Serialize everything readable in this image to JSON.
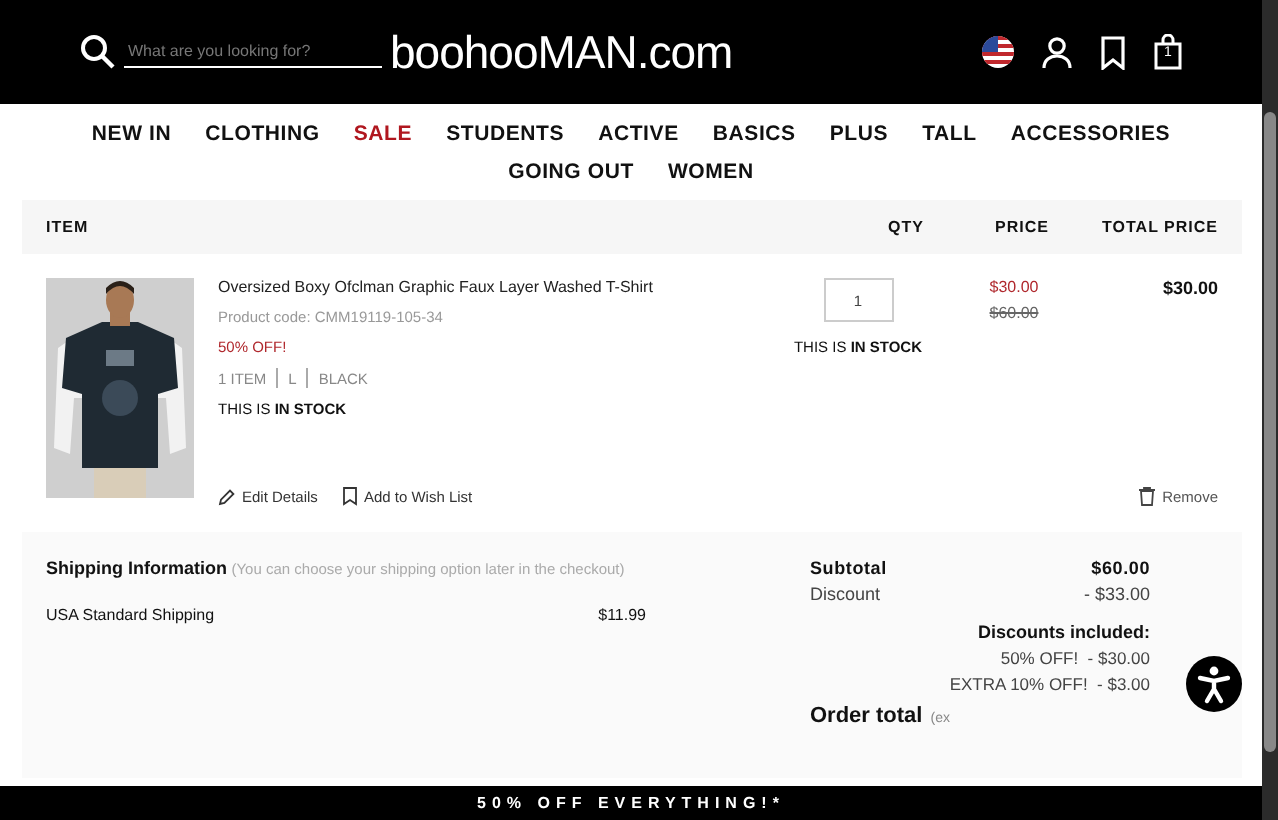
{
  "header": {
    "search": {
      "placeholder": "What are you looking for?"
    },
    "logo": "boohooMAN.com",
    "cart_count": "1"
  },
  "nav": [
    {
      "label": "NEW IN",
      "sale": false
    },
    {
      "label": "CLOTHING",
      "sale": false
    },
    {
      "label": "SALE",
      "sale": true
    },
    {
      "label": "STUDENTS",
      "sale": false
    },
    {
      "label": "ACTIVE",
      "sale": false
    },
    {
      "label": "BASICS",
      "sale": false
    },
    {
      "label": "PLUS",
      "sale": false
    },
    {
      "label": "TALL",
      "sale": false
    },
    {
      "label": "ACCESSORIES",
      "sale": false
    },
    {
      "label": "GOING OUT",
      "sale": false
    },
    {
      "label": "WOMEN",
      "sale": false
    }
  ],
  "table": {
    "columns": [
      "ITEM",
      "QTY",
      "PRICE",
      "TOTAL PRICE"
    ],
    "rows": [
      {
        "name": "Oversized Boxy Ofclman Graphic Faux Layer Washed T-Shirt",
        "code": "Product code: CMM19119-105-34",
        "promo": "50% OFF!",
        "attributes": [
          "1 ITEM",
          "L",
          "BLACK"
        ],
        "stock_prefix": "THIS IS",
        "stock": "IN STOCK",
        "qty": "1",
        "qty_stock_prefix": "THIS IS",
        "qty_stock": "IN STOCK",
        "price": "$30.00",
        "was_price": "$60.00",
        "total": "$30.00",
        "actions": [
          "Edit Details",
          "Add to Wish List"
        ],
        "remove": "Remove"
      }
    ]
  },
  "shipping": {
    "title": "Shipping Information",
    "note": "(You can choose your shipping option later in the checkout)",
    "option": "USA Standard Shipping",
    "cost": "$11.99"
  },
  "summary": {
    "lines": [
      {
        "label": "Subtotal",
        "value": "$60.00",
        "kind": "bold"
      },
      {
        "label": "Discount",
        "value": "- $33.00",
        "kind": "plain"
      }
    ],
    "discounts_title": "Discounts included:",
    "discounts": [
      {
        "label": "50% OFF!",
        "value": "- $30.00"
      },
      {
        "label": "EXTRA 10% OFF!",
        "value": "- $3.00"
      }
    ],
    "order_total": "Order total",
    "order_total_note": "(ex"
  },
  "banner": "50% OFF EVERYTHING!*"
}
